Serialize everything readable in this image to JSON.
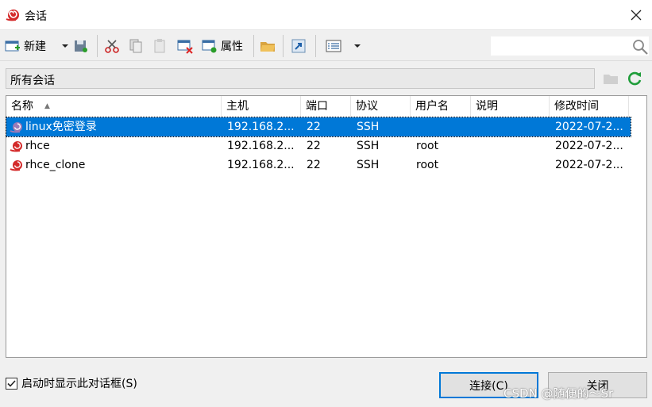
{
  "window": {
    "title": "会话",
    "app_icon": "snail-icon",
    "close_icon": "close-icon"
  },
  "toolbar": {
    "new_label": "新建",
    "properties_label": "属性",
    "items": [
      "new-session-icon",
      "dropdown-arrow-icon",
      "save-icon",
      "cut-icon",
      "copy-icon",
      "paste-icon",
      "delete-icon",
      "properties-icon",
      "open-folder-icon",
      "shortcut-icon",
      "view-icon",
      "dropdown-arrow-icon"
    ]
  },
  "search": {
    "value": "",
    "icon": "search-icon"
  },
  "path": {
    "label": "所有会话"
  },
  "columns": {
    "name": "名称",
    "host": "主机",
    "port": "端口",
    "protocol": "协议",
    "user": "用户名",
    "description": "说明",
    "modified": "修改时间"
  },
  "sessions": [
    {
      "name": "linux免密登录",
      "host": "192.168.2...",
      "port": "22",
      "protocol": "SSH",
      "user": "",
      "description": "",
      "modified": "2022-07-2..."
    },
    {
      "name": "rhce",
      "host": "192.168.2...",
      "port": "22",
      "protocol": "SSH",
      "user": "root",
      "description": "",
      "modified": "2022-07-2..."
    },
    {
      "name": "rhce_clone",
      "host": "192.168.2...",
      "port": "22",
      "protocol": "SSH",
      "user": "root",
      "description": "",
      "modified": "2022-07-2..."
    }
  ],
  "footer": {
    "show_on_start_label": "启动时显示此对话框(S)",
    "show_on_start_checked": true,
    "connect_label": "连接(C)",
    "close_label": "关闭"
  },
  "watermark": "CSDN @随便的～Sr",
  "colors": {
    "selection": "#0078d7",
    "accent": "#0078d7"
  }
}
